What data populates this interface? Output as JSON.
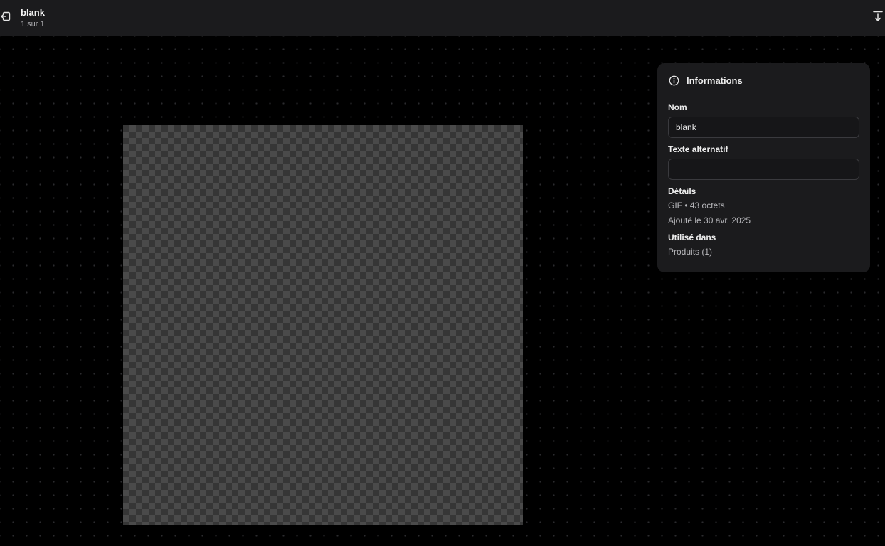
{
  "header": {
    "title": "blank",
    "counter": "1 sur 1",
    "back_icon": "exit-to-back-icon",
    "download_icon": "download-icon"
  },
  "info_panel": {
    "heading": "Informations",
    "heading_icon": "info-circle-icon",
    "name": {
      "label": "Nom",
      "value": "blank",
      "placeholder": ""
    },
    "alt_text": {
      "label": "Texte alternatif",
      "value": "",
      "placeholder": ""
    },
    "details": {
      "label": "Détails",
      "format_size": "GIF • 43 octets",
      "added": "Ajouté le 30 avr. 2025"
    },
    "used_in": {
      "label": "Utilisé dans",
      "items": [
        "Produits (1)"
      ]
    }
  },
  "colors": {
    "background": "#000000",
    "topbar": "#1b1b1d",
    "panel": "#1b1b1d",
    "checker_dark": "#363636",
    "checker_light": "#4a4a4a"
  }
}
